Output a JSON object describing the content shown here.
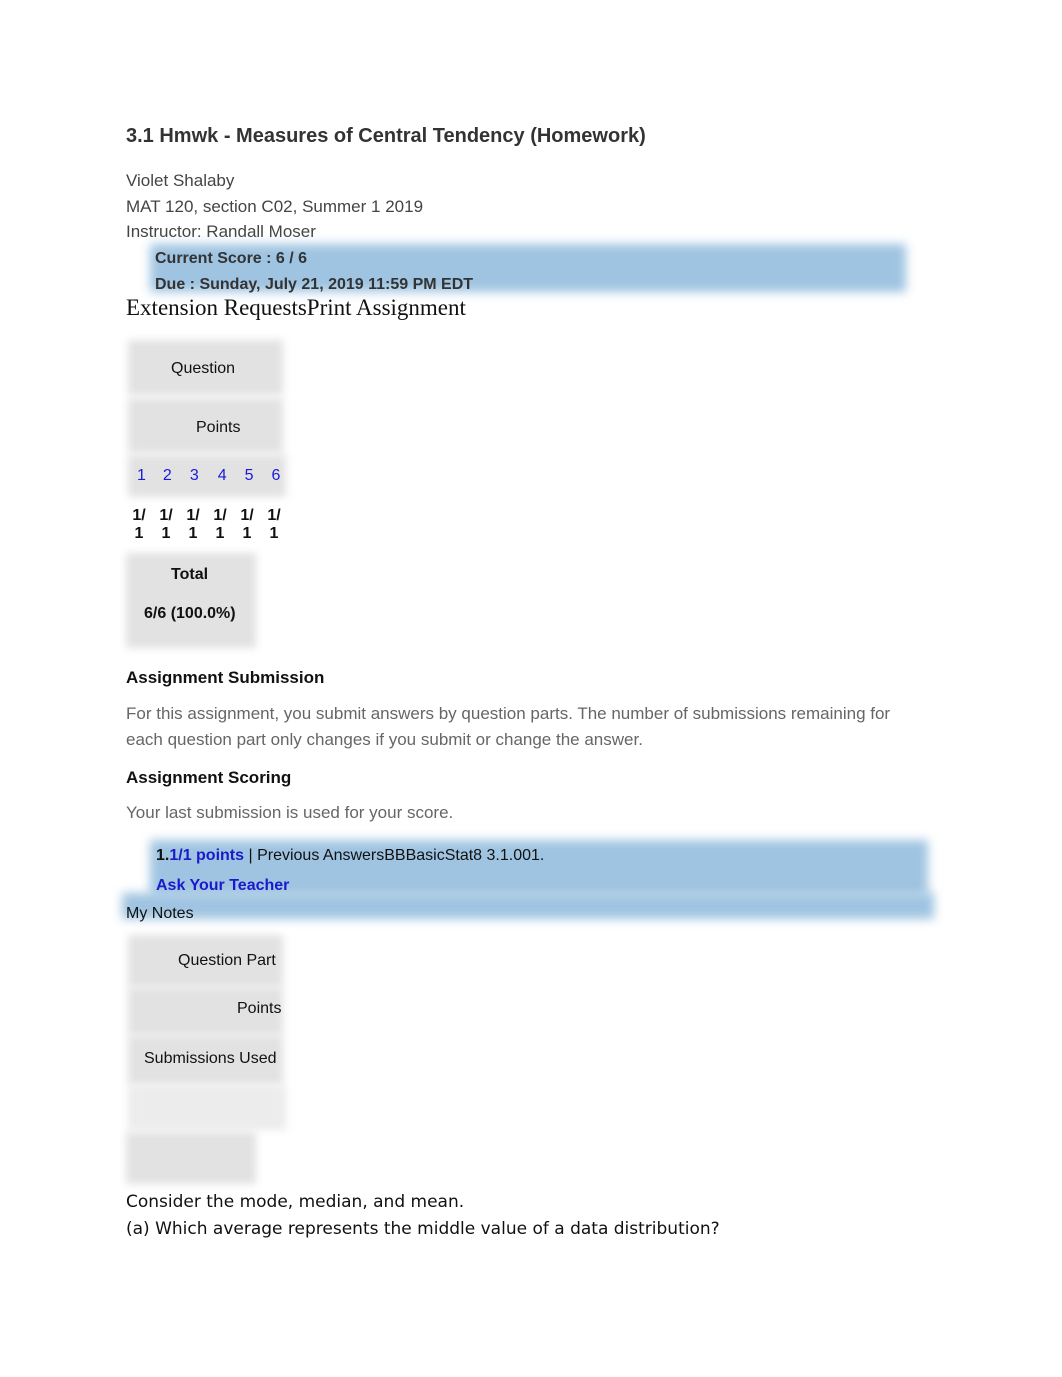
{
  "assignment": {
    "title": "3.1 Hmwk - Measures of Central Tendency (Homework)",
    "student": "Violet Shalaby",
    "course": "MAT 120, section C02, Summer 1 2019",
    "instructor": "Instructor: Randall Moser",
    "current_score": "Current Score : 6 / 6",
    "due": "Due : Sunday, July 21, 2019 11:59 PM EDT"
  },
  "actions": {
    "extension_requests": "Extension Requests",
    "print_assignment": "Print Assignment"
  },
  "score_table": {
    "question_header": "Question",
    "points_header": "Points",
    "questions": [
      "1",
      "2",
      "3",
      "4",
      "5",
      "6"
    ],
    "points": [
      {
        "top": "1/",
        "bottom": "1"
      },
      {
        "top": "1/",
        "bottom": "1"
      },
      {
        "top": "1/",
        "bottom": "1"
      },
      {
        "top": "1/",
        "bottom": "1"
      },
      {
        "top": "1/",
        "bottom": "1"
      },
      {
        "top": "1/",
        "bottom": "1"
      }
    ],
    "total_label": "Total",
    "total_value": "6/6 (100.0%)"
  },
  "submission": {
    "heading": "Assignment Submission",
    "text": "For this assignment, you submit answers by question parts. The number of submissions remaining for each question part only changes if you submit or change the answer."
  },
  "scoring": {
    "heading": "Assignment Scoring",
    "text": "Your last submission is used for your score."
  },
  "question1": {
    "number": "1.",
    "points": "1/1 points",
    "separator": " | ",
    "previous_answers": "Previous Answers",
    "code": "BBBasicStat8 3.1.001.",
    "ask_teacher": "Ask Your Teacher",
    "my_notes": "My Notes",
    "part_table": {
      "question_part_header": "Question Part",
      "points_header": "Points",
      "submissions_header": "Submissions Used"
    },
    "prompt": "Consider the mode, median, and mean.",
    "part_a": "(a) Which average represents the middle value of a data distribution?"
  }
}
